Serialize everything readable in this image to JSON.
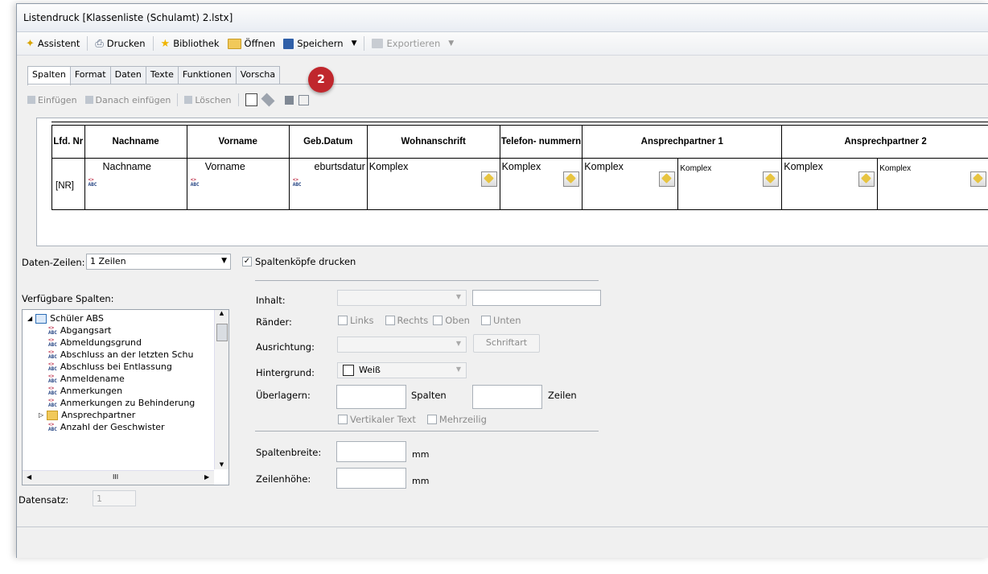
{
  "window": {
    "title": "Listendruck [Klassenliste (Schulamt) 2.lstx]"
  },
  "toolbar": {
    "assistent": "Assistent",
    "drucken": "Drucken",
    "bibliothek": "Bibliothek",
    "oeffnen": "Öffnen",
    "speichern": "Speichern",
    "exportieren": "Exportieren"
  },
  "tabs": [
    "Spalten",
    "Format",
    "Daten",
    "Texte",
    "Funktionen",
    "Vorscha"
  ],
  "subtoolbar": {
    "einfuegen": "Einfügen",
    "danach_einfuegen": "Danach einfügen",
    "loeschen": "Löschen"
  },
  "badge": "2",
  "grid": {
    "headers": [
      "Lfd. Nr",
      "Nachname",
      "Vorname",
      "Geb.Datum",
      "Wohnanschrift",
      "Telefon- nummern",
      "Ansprechpartner 1",
      "Ansprechpartner 2"
    ],
    "row": {
      "nr": "[NR]",
      "nachname": "Nachname",
      "vorname": "Vorname",
      "gebdatum": "eburtsdatur",
      "wohnanschrift": "Komplex",
      "telefon": "Komplex",
      "ap1a": "Komplex",
      "ap1b": "Komplex",
      "ap2a": "Komplex",
      "ap2b": "Komplex"
    }
  },
  "datenzeilen": {
    "label": "Daten-Zeilen:",
    "value": "1 Zeilen"
  },
  "spaltenkoepfe": {
    "label": "Spaltenköpfe drucken",
    "checked": true
  },
  "verfuegbare": {
    "label": "Verfügbare Spalten:"
  },
  "tree": {
    "root": "Schüler ABS",
    "items": [
      "Abgangsart",
      "Abmeldungsgrund",
      "Abschluss an der letzten Schu",
      "Abschluss bei Entlassung",
      "Anmeldename",
      "Anmerkungen",
      "Anmerkungen zu Behinderung",
      "Ansprechpartner",
      "Anzahl der Geschwister"
    ],
    "hscroll": "III"
  },
  "props": {
    "inhalt": "Inhalt:",
    "raender": "Ränder:",
    "links": "Links",
    "rechts": "Rechts",
    "oben": "Oben",
    "unten": "Unten",
    "ausrichtung": "Ausrichtung:",
    "schriftart": "Schriftart",
    "hintergrund": "Hintergrund:",
    "hintergrund_value": "Weiß",
    "ueberlagern": "Überlagern:",
    "spalten": "Spalten",
    "zeilen": "Zeilen",
    "vertikal": "Vertikaler Text",
    "mehrzeilig": "Mehrzeilig",
    "spaltenbreite": "Spaltenbreite:",
    "zeilenhoehe": "Zeilenhöhe:",
    "mm": "mm"
  },
  "datensatz": {
    "label": "Datensatz:",
    "value": "1"
  }
}
